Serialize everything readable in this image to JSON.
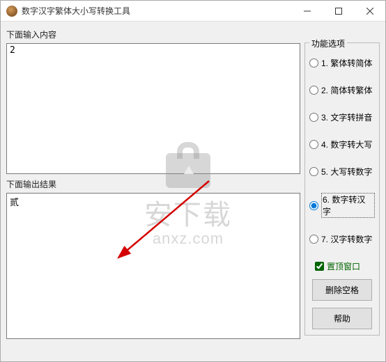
{
  "window": {
    "title": "数字汉字繁体大小写转换工具"
  },
  "input": {
    "label": "下面输入内容",
    "value": "2"
  },
  "output": {
    "label": "下面输出结果",
    "value": "贰"
  },
  "options": {
    "group_label": "功能选项",
    "items": [
      {
        "label": "1. 繁体转简体",
        "checked": false
      },
      {
        "label": "2. 简体转繁体",
        "checked": false
      },
      {
        "label": "3. 文字转拼音",
        "checked": false
      },
      {
        "label": "4. 数字转大写",
        "checked": false
      },
      {
        "label": "5. 大写转数字",
        "checked": false
      },
      {
        "label": "6. 数字转汉字",
        "checked": true
      },
      {
        "label": "7. 汉字转数字",
        "checked": false
      }
    ],
    "topmost": {
      "label": "置顶窗口",
      "checked": true
    }
  },
  "buttons": {
    "remove_spaces": "删除空格",
    "help": "帮助"
  },
  "watermark": {
    "cn": "安下载",
    "en": "anxz.com"
  }
}
